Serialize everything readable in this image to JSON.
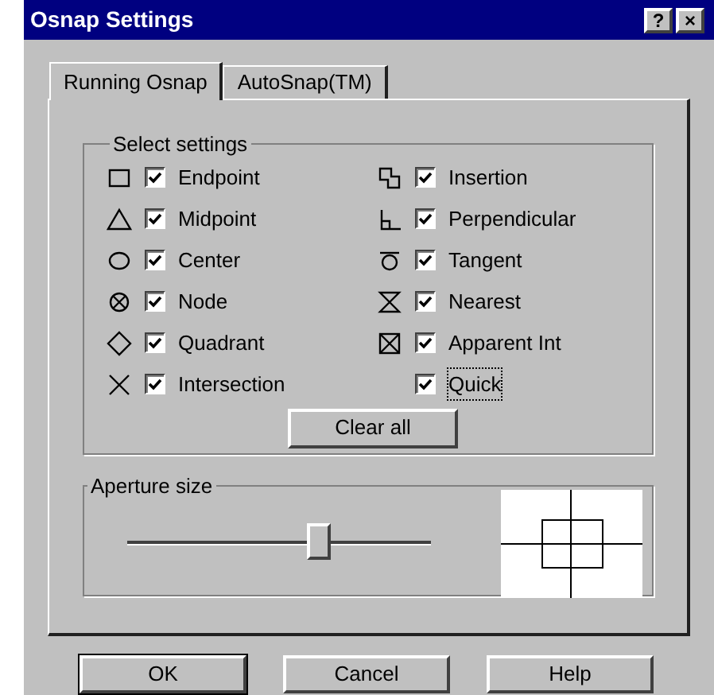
{
  "window": {
    "title": "Osnap Settings",
    "buttons": [
      "?",
      "×"
    ]
  },
  "tabs": [
    {
      "label": "Running Osnap",
      "selected": true
    },
    {
      "label": "AutoSnap(TM)",
      "selected": false
    }
  ],
  "select_settings": {
    "title": "Select settings",
    "items": [
      {
        "kind": "square",
        "label": "Endpoint",
        "checked": true
      },
      {
        "kind": "insertion",
        "label": "Insertion",
        "checked": true
      },
      {
        "kind": "triangle",
        "label": "Midpoint",
        "checked": true
      },
      {
        "kind": "perpendicular",
        "label": "Perpendicular",
        "checked": true
      },
      {
        "kind": "circle",
        "label": "Center",
        "checked": true
      },
      {
        "kind": "tangent",
        "label": "Tangent",
        "checked": true
      },
      {
        "kind": "node",
        "label": "Node",
        "checked": true
      },
      {
        "kind": "nearest",
        "label": "Nearest",
        "checked": true
      },
      {
        "kind": "diamond",
        "label": "Quadrant",
        "checked": true
      },
      {
        "kind": "apparent",
        "label": "Apparent Int",
        "checked": true
      },
      {
        "kind": "cross",
        "label": "Intersection",
        "checked": true
      },
      {
        "kind": "plain",
        "label": "Quick",
        "checked": true,
        "focused": true
      }
    ],
    "clear_button": "Clear all"
  },
  "aperture": {
    "title": "Aperture size",
    "level": 0.63
  },
  "buttons": [
    {
      "label": "OK",
      "default": true
    },
    {
      "label": "Cancel",
      "default": false
    },
    {
      "label": "Help",
      "default": false
    }
  ]
}
